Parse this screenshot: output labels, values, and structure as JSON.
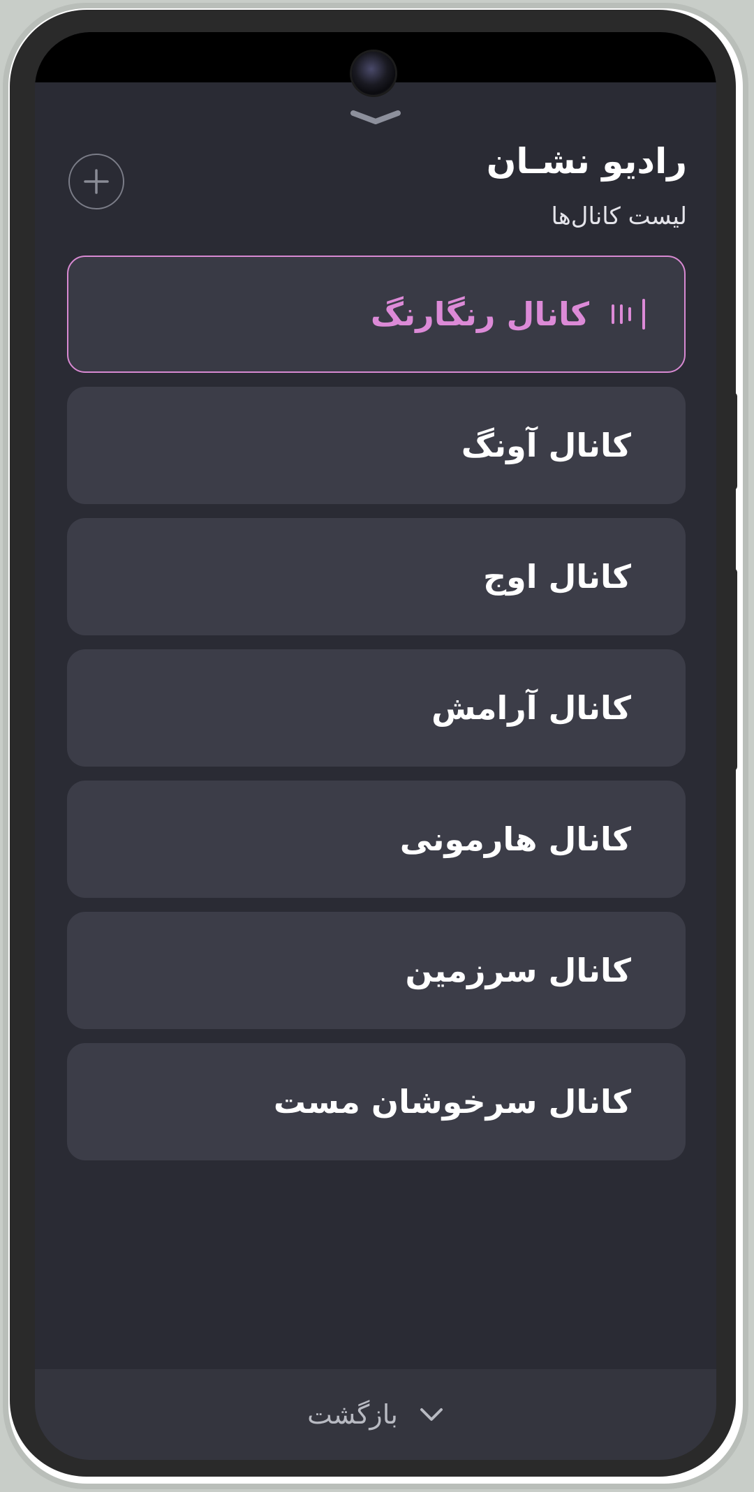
{
  "app": {
    "title": "رادیو نشـان",
    "subtitle": "لیست کانال‌ها"
  },
  "channels": [
    {
      "label": "کانال رنگارنگ",
      "active": true
    },
    {
      "label": "کانال آونگ",
      "active": false
    },
    {
      "label": "کانال اوج",
      "active": false
    },
    {
      "label": "کانال آرامش",
      "active": false
    },
    {
      "label": "کانال هارمونی",
      "active": false
    },
    {
      "label": "کانال سرزمین",
      "active": false
    },
    {
      "label": "کانال سرخوشان مست",
      "active": false
    }
  ],
  "footer": {
    "back_label": "بازگشت"
  },
  "icons": {
    "add": "plus-icon",
    "now_playing": "equalizer-icon",
    "back": "chevron-down-icon",
    "handle": "drag-handle-icon"
  },
  "colors": {
    "background": "#2a2b34",
    "card": "#3c3d48",
    "accent": "#dc8ad7",
    "text": "#ffffff",
    "muted": "#b8bac2"
  }
}
